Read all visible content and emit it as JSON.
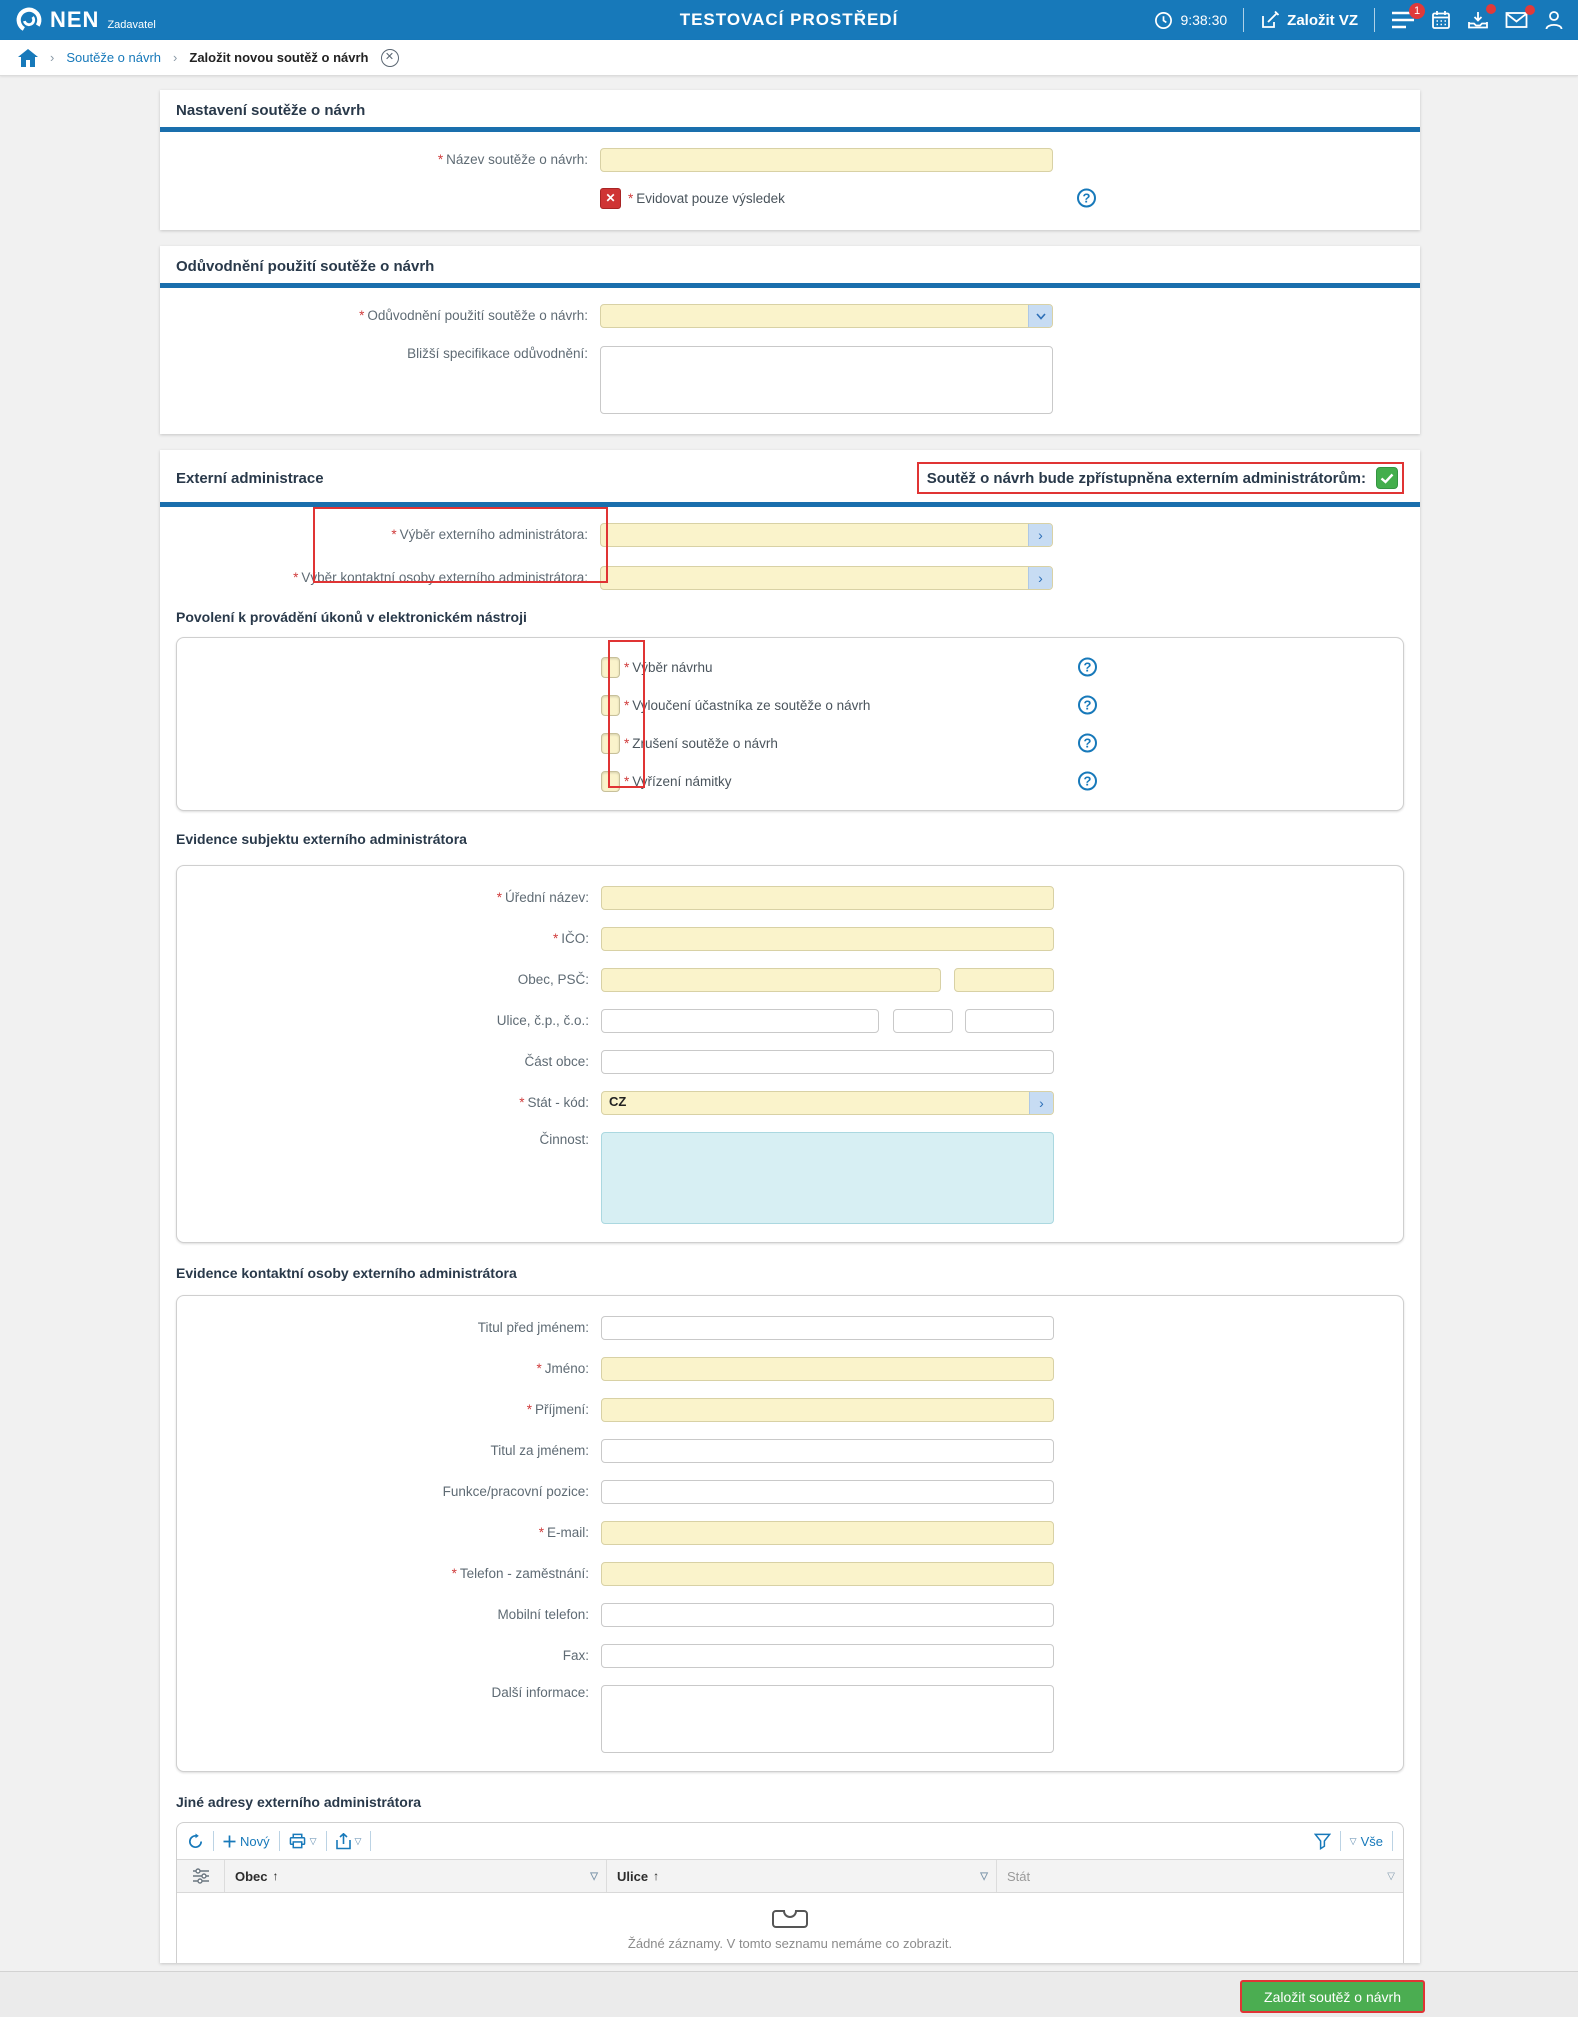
{
  "header": {
    "brand": "NEN",
    "brand_sub": "Zadavatel",
    "title": "TESTOVACÍ PROSTŘEDÍ",
    "time": "9:38:30",
    "create_button": "Založit VZ",
    "notifications_badge": "1"
  },
  "breadcrumb": {
    "items": [
      "Soutěže o návrh",
      "Založit novou soutěž o návrh"
    ]
  },
  "section_nastaveni": {
    "title": "Nastavení soutěže o návrh",
    "nazev_label": "Název soutěže o návrh:",
    "evidovat_label": "Evidovat pouze výsledek"
  },
  "section_oduvodneni": {
    "title": "Odůvodnění použití soutěže o návrh",
    "oduvodneni_label": "Odůvodnění použití soutěže o návrh:",
    "blizsi_label": "Bližší specifikace odůvodnění:"
  },
  "section_externi": {
    "title": "Externí administrace",
    "banner": "Soutěž o návrh bude zpřístupněna externím administrátorům:",
    "vyber_admin_label": "Výběr externího administrátora:",
    "vyber_kontakt_label": "Výběr kontaktní osoby externího administrátora:",
    "povoleni": {
      "title": "Povolení k provádění úkonů v elektronickém nástroji",
      "items": [
        "Výběr návrhu",
        "Vyloučení účastníka ze soutěže o návrh",
        "Zrušení soutěže o návrh",
        "Vyřízení námitky"
      ]
    },
    "subjekt": {
      "title": "Evidence subjektu externího administrátora",
      "uredni_nazev_label": "Úřední název:",
      "ico_label": "IČO:",
      "obec_psc_label": "Obec, PSČ:",
      "ulice_label": "Ulice, č.p., č.o.:",
      "cast_obce_label": "Část obce:",
      "stat_kod_label": "Stát - kód:",
      "stat_kod_value": "CZ",
      "cinnost_label": "Činnost:"
    },
    "kontakt": {
      "title": "Evidence kontaktní osoby externího administrátora",
      "titul_pred_label": "Titul před jménem:",
      "jmeno_label": "Jméno:",
      "prijmeni_label": "Příjmení:",
      "titul_za_label": "Titul za jménem:",
      "funkce_label": "Funkce/pracovní pozice:",
      "email_label": "E-mail:",
      "telefon_label": "Telefon - zaměstnání:",
      "mobil_label": "Mobilní telefon:",
      "fax_label": "Fax:",
      "dalsi_label": "Další informace:"
    },
    "adresy": {
      "title": "Jiné adresy externího administrátora",
      "toolbar_novy": "Nový",
      "toolbar_vse": "Vše",
      "col_obec": "Obec",
      "col_ulice": "Ulice",
      "col_stat": "Stát",
      "empty": "Žádné záznamy. V tomto seznamu nemáme co zobrazit."
    }
  },
  "footer": {
    "submit": "Založit soutěž o návrh"
  },
  "colors": {
    "header_blue": "#1779ba",
    "section_bar_blue": "#1a6fad",
    "required_red": "#d03c3c",
    "input_yellow": "#faf3cb",
    "info_cyan": "#d7eff3",
    "success_green": "#43ae4c",
    "annotation_red": "#e03434",
    "button_green": "#4bad51"
  }
}
